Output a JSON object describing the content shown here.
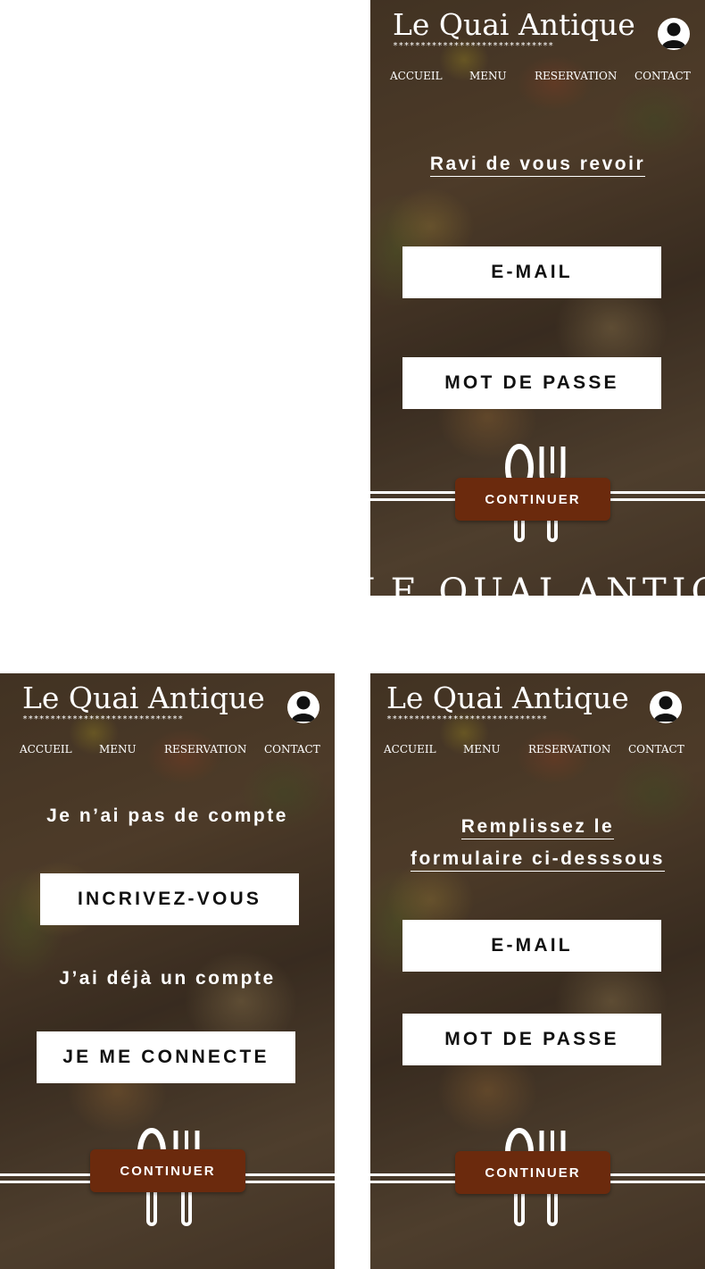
{
  "brand": {
    "name": "Le Quai Antique",
    "stars": "*****************************"
  },
  "nav": {
    "items": [
      "ACCUEIL",
      "MENU",
      "RESERVATION",
      "CONTACT"
    ]
  },
  "icons": {
    "user": "user-account-icon",
    "emblem": "fork-spoon-emblem-icon"
  },
  "colors": {
    "accent": "#6b2a0d",
    "field_bg": "#ffffff",
    "text": "#ffffff"
  },
  "login": {
    "heading": "Ravi de vous revoir",
    "email_placeholder": "E-MAIL",
    "password_placeholder": "MOT DE PASSE",
    "continue_label": "CONTINUER",
    "footer_text": "LE QUAI ANTIQUE"
  },
  "choice": {
    "no_account_text": "Je n’ai pas de compte",
    "signup_label": "INCRIVEZ-VOUS",
    "has_account_text": "J’ai déjà un compte",
    "login_label": "JE ME CONNECTE",
    "continue_label": "CONTINUER"
  },
  "signup": {
    "heading_line1": "Remplissez le",
    "heading_line2": "formulaire ci-desssous",
    "email_placeholder": "E-MAIL",
    "password_placeholder": "MOT DE PASSE",
    "continue_label": "CONTINUER"
  }
}
